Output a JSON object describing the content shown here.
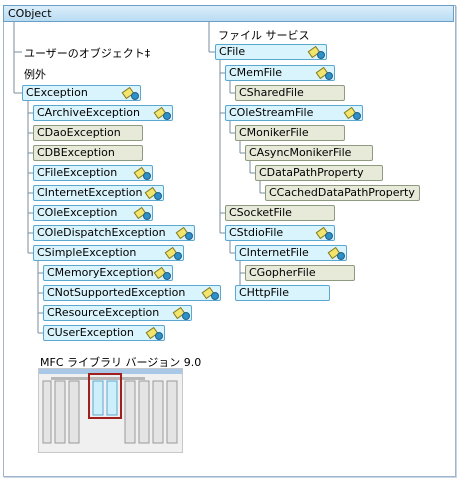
{
  "root": "CObject",
  "left_section": {
    "user_objects_label": "ユーザーのオブジェクト‡",
    "exceptions_label": "例外"
  },
  "right_section": {
    "file_services_label": "ファイル サービス"
  },
  "nodes": [
    {
      "label": "CException"
    },
    {
      "label": "CArchiveException"
    },
    {
      "label": "CDaoException"
    },
    {
      "label": "CDBException"
    },
    {
      "label": "CFileException"
    },
    {
      "label": "CInternetException"
    },
    {
      "label": "COleException"
    },
    {
      "label": "COleDispatchException"
    },
    {
      "label": "CSimpleException"
    },
    {
      "label": "CMemoryException"
    },
    {
      "label": "CNotSupportedException"
    },
    {
      "label": "CResourceException"
    },
    {
      "label": "CUserException"
    },
    {
      "label": "CFile"
    },
    {
      "label": "CMemFile"
    },
    {
      "label": "CSharedFile"
    },
    {
      "label": "COleStreamFile"
    },
    {
      "label": "CMonikerFile"
    },
    {
      "label": "CAsyncMonikerFile"
    },
    {
      "label": "CDataPathProperty"
    },
    {
      "label": "CCachedDataPathProperty"
    },
    {
      "label": "CSocketFile"
    },
    {
      "label": "CStdioFile"
    },
    {
      "label": "CInternetFile"
    },
    {
      "label": "CGopherFile"
    },
    {
      "label": "CHttpFile"
    }
  ],
  "legend": {
    "title": "MFC ライブラリ バージョン 9.0"
  }
}
